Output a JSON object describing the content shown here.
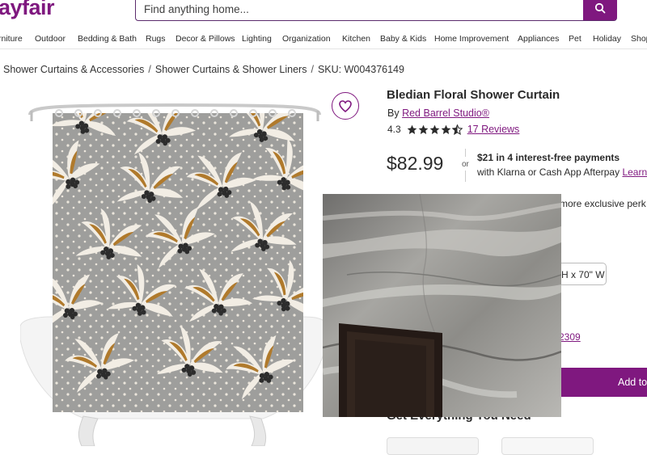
{
  "brand": {
    "logo_text": "ayfair",
    "accent_color": "#7f187f"
  },
  "search": {
    "placeholder": "Find anything home...",
    "icon": "search-icon"
  },
  "nav": {
    "items": [
      "rniture",
      "Outdoor",
      "Bedding & Bath",
      "Rugs",
      "Decor & Pillows",
      "Lighting",
      "Organization",
      "Kitchen",
      "Baby & Kids",
      "Home Improvement",
      "Appliances",
      "Pet",
      "Holiday",
      "Shop"
    ]
  },
  "breadcrumb": {
    "items": [
      "Shower Curtains & Accessories",
      "Shower Curtains & Shower Liners"
    ],
    "sku": "SKU: W004376149"
  },
  "product": {
    "title": "Bledian Floral Shower Curtain",
    "by_label": "By",
    "brand_link": "Red Barrel Studio®",
    "rating_value": "4.3",
    "rating": 4.3,
    "reviews_link": "17 Reviews",
    "price": "$82.99",
    "or_label": "or",
    "installments_bold": "$21 in 4 interest-free payments",
    "installments_text": "with Klarna or Cash App Afterpay",
    "learn_link": "Learn",
    "perks_text": "more exclusive perk",
    "size_option": "H x 70\" W",
    "sku_link_fragment": "2309",
    "add_to_cart": "Add to",
    "section_title": "Get Everything You Need"
  },
  "icons": {
    "wishlist": "heart-icon",
    "star": "star-icon"
  }
}
